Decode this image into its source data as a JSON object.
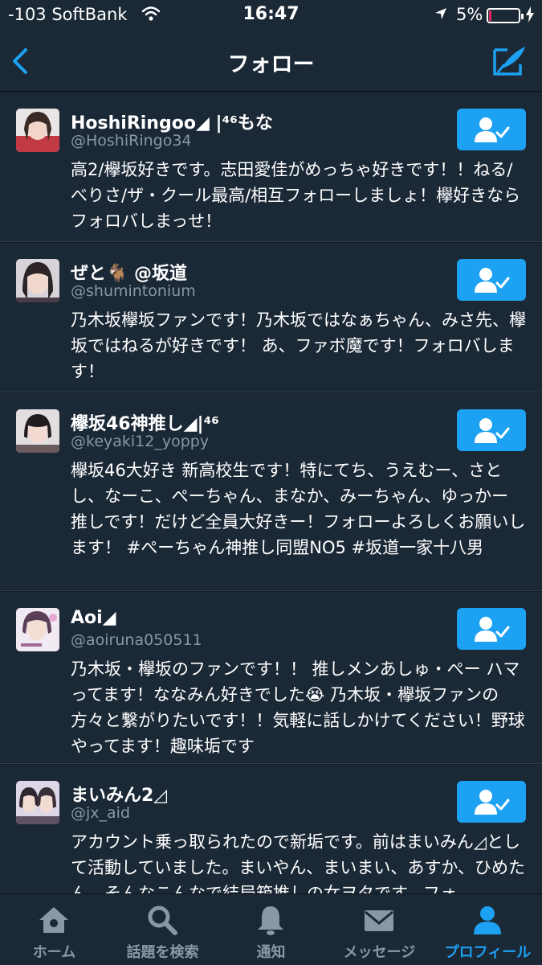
{
  "status_bar": {
    "carrier": "-103 SoftBank",
    "time": "16:47",
    "battery_percent": "5%",
    "battery_level": 0.05,
    "battery_color": "#e0245e"
  },
  "nav": {
    "title": "フォロー",
    "back_icon": "chevron-left-icon",
    "compose_icon": "compose-tweet-icon"
  },
  "accent_color": "#1da1f2",
  "users": [
    {
      "name": "HoshiRingoo◢ |⁴⁶もな",
      "handle": "@HoshiRingo34",
      "bio": "高2/欅坂好きです。志田愛佳がめっちゃ好きです！！ねる/べりさ/ザ・クール最高/相互フォローしましょ！欅好きならフォロバしまっせ！",
      "following": true
    },
    {
      "name": "ぜと🐐 @坂道",
      "handle": "@shumintonium",
      "bio": "乃木坂欅坂ファンです！乃木坂ではなぁちゃん、みさ先、欅坂ではねるが好きです！ あ、ファボ魔です！フォロバします！",
      "following": true
    },
    {
      "name": "欅坂46神推し◢|⁴⁶",
      "handle": "@keyaki12_yoppy",
      "bio": "欅坂46大好き 新高校生です！特にてち、うえむー、さとし、なーこ、ぺーちゃん、まなか、みーちゃん、ゆっかー 推しです！だけど全員大好きー！フォローよろしくお願いします！ #ぺーちゃん神推し同盟NO5 #坂道一家十八男",
      "following": true
    },
    {
      "name": "Aoi◢",
      "handle": "@aoiruna050511",
      "bio": "乃木坂・欅坂のファンです！！ 推しメンあしゅ・ぺー ハマってます！ななみん好きでした😭 乃木坂・欅坂ファンの方々と繋がりたいです！！気軽に話しかけてください！野球やってます！趣味垢です",
      "following": true
    },
    {
      "name": "まいみん2◿",
      "handle": "@jx_aid",
      "bio": "アカウント乗っ取られたので新垢です。前はまいみん◿として活動していました。まいやん、まいまい、あすか、ひめたん…そんなこんなで結局箱推しの女ヲタです。フォ",
      "following": true
    }
  ],
  "tabs": [
    {
      "label": "ホーム",
      "icon": "home-icon",
      "active": false
    },
    {
      "label": "話題を検索",
      "icon": "search-icon",
      "active": false
    },
    {
      "label": "通知",
      "icon": "bell-icon",
      "active": false
    },
    {
      "label": "メッセージ",
      "icon": "envelope-icon",
      "active": false
    },
    {
      "label": "プロフィール",
      "icon": "person-icon",
      "active": true
    }
  ]
}
